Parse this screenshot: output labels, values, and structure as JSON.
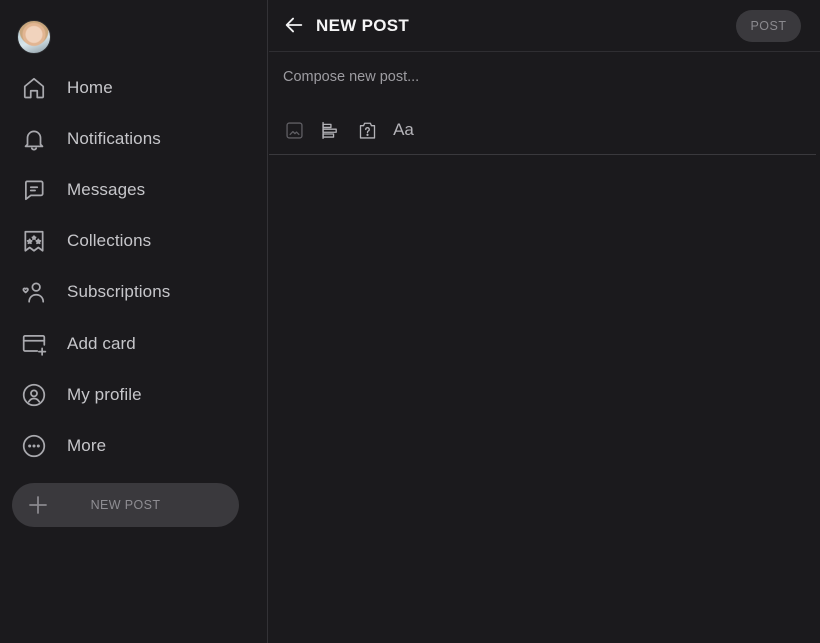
{
  "sidebar": {
    "items": [
      {
        "label": "Home",
        "icon": "home-icon"
      },
      {
        "label": "Notifications",
        "icon": "bell-icon"
      },
      {
        "label": "Messages",
        "icon": "message-icon"
      },
      {
        "label": "Collections",
        "icon": "collections-icon"
      },
      {
        "label": "Subscriptions",
        "icon": "subscriptions-icon"
      },
      {
        "label": "Add card",
        "icon": "add-card-icon"
      },
      {
        "label": "My profile",
        "icon": "profile-icon"
      },
      {
        "label": "More",
        "icon": "more-icon"
      }
    ],
    "new_post_label": "NEW POST"
  },
  "header": {
    "title": "NEW POST",
    "post_label": "POST"
  },
  "composer": {
    "placeholder": "Compose new post...",
    "format_label": "Aa"
  },
  "colors": {
    "background": "#1b1a1d",
    "button_bg": "#3a393d",
    "text_primary": "#f4f4f5",
    "text_secondary": "#c6c6ca"
  }
}
